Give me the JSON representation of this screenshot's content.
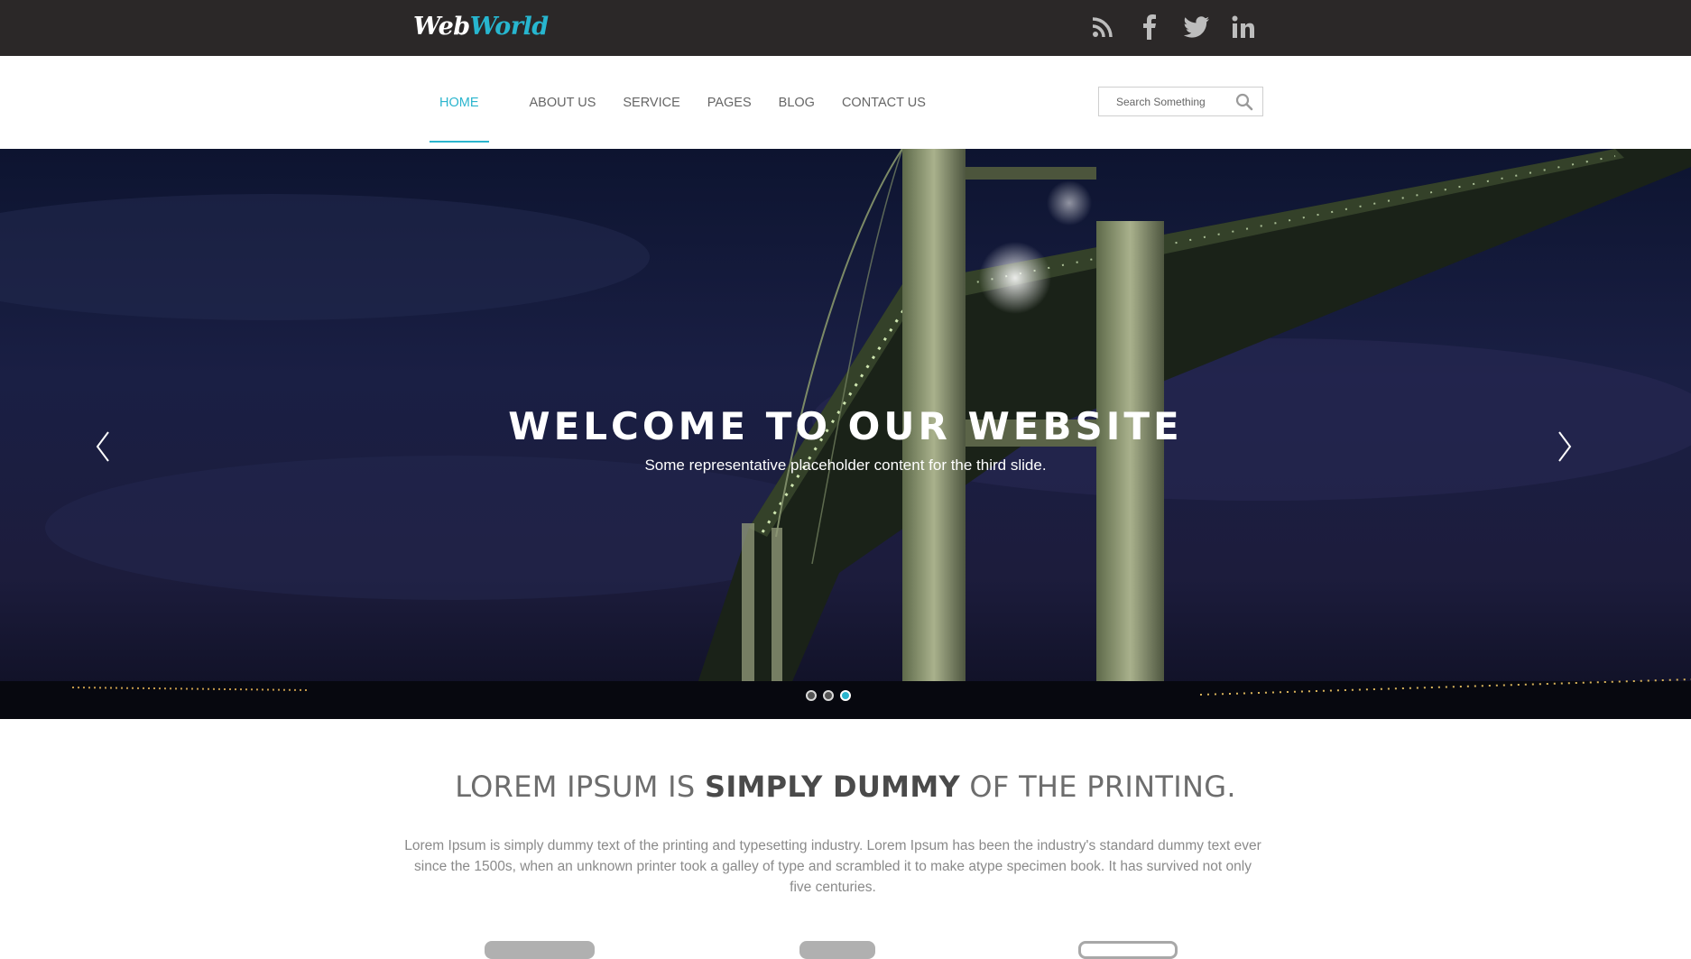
{
  "brand": {
    "logo_part1": "Web",
    "logo_part2": "World"
  },
  "social": [
    "rss-icon",
    "facebook-icon",
    "twitter-icon",
    "linkedin-icon"
  ],
  "nav": {
    "items": [
      {
        "label": "HOME",
        "active": true
      },
      {
        "label": "ABOUT US"
      },
      {
        "label": "SERVICE"
      },
      {
        "label": "PAGES"
      },
      {
        "label": "BLOG"
      },
      {
        "label": "CONTACT US"
      }
    ],
    "search_placeholder": "Search Something"
  },
  "hero": {
    "title": "WELCOME TO OUR WEBSITE",
    "subtitle": "Some representative placeholder content for the third slide.",
    "slides_total": 3,
    "active_slide": 3
  },
  "intro": {
    "title_part1": "LOREM IPSUM IS ",
    "title_bold": "SIMPLY DUMMY",
    "title_part2": " OF THE PRINTING.",
    "body": "Lorem Ipsum is simply dummy text of the printing and typesetting industry. Lorem Ipsum has been the industry's standard dummy text ever since the 1500s, when an unknown printer took a galley of type and scrambled it to make atype specimen book. It has survived not only five centuries."
  },
  "colors": {
    "accent": "#2bb5ce",
    "topbar": "#2b2828"
  }
}
